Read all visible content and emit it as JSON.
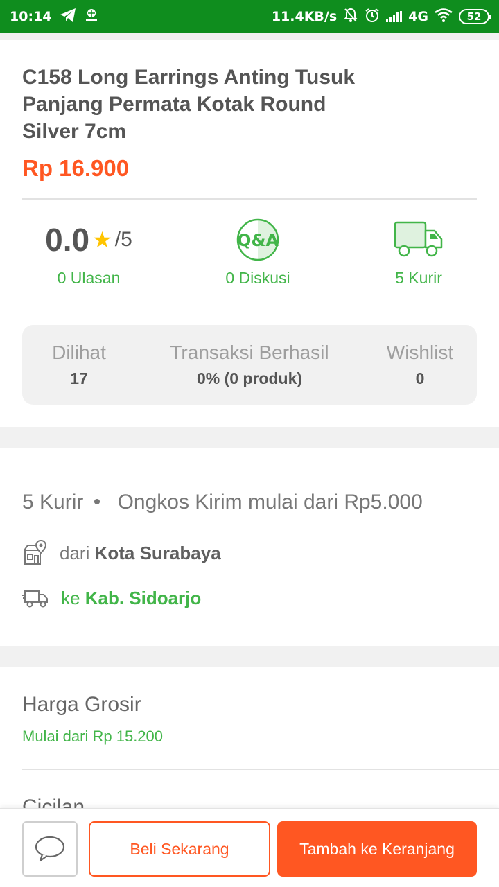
{
  "status_bar": {
    "time": "10:14",
    "network_speed": "11.4KB/s",
    "network_type": "4G",
    "battery": "52",
    "icons": [
      "telegram-icon",
      "app-icon",
      "mute-icon",
      "alarm-icon",
      "signal-icon",
      "wifi-icon",
      "battery-icon"
    ]
  },
  "product": {
    "title": "C158 Long Earrings Anting Tusuk Panjang Permata Kotak Round Silver 7cm",
    "price": "Rp 16.900"
  },
  "stats": {
    "rating_value": "0.0",
    "rating_max": "/5",
    "reviews_link": "0 Ulasan",
    "qa_badge": "Q&A",
    "discussion_link": "0 Diskusi",
    "courier_link": "5 Kurir"
  },
  "info_box": {
    "seen_label": "Dilihat",
    "seen_value": "17",
    "transactions_label": "Transaksi Berhasil",
    "transactions_value": "0% (0 produk)",
    "wishlist_label": "Wishlist",
    "wishlist_value": "0"
  },
  "shipping": {
    "couriers": "5 Kurir",
    "bullet": "•",
    "cost_text": "Ongkos Kirim mulai dari Rp5.000",
    "from_prefix": "dari",
    "from_city": "Kota Surabaya",
    "to_prefix": "ke",
    "to_city": "Kab. Sidoarjo"
  },
  "wholesale": {
    "title": "Harga Grosir",
    "subtitle": "Mulai dari Rp 15.200",
    "next_section": "Cicilan"
  },
  "actions": {
    "buy_now": "Beli Sekarang",
    "add_to_cart": "Tambah ke Keranjang"
  },
  "colors": {
    "status_bar": "#0f8d1e",
    "accent_orange": "#ff5722",
    "accent_green": "#42b549",
    "star": "#ffc400"
  }
}
